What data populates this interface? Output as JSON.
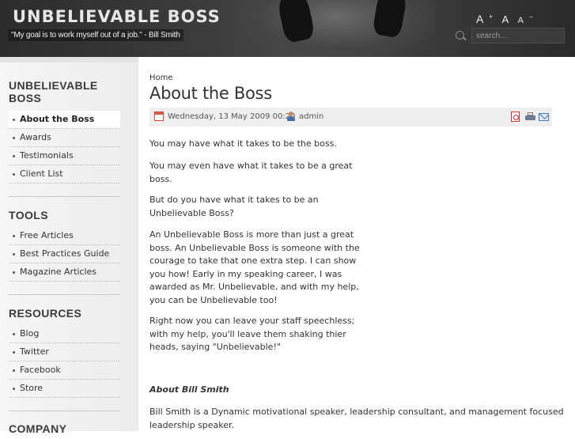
{
  "header": {
    "site_title": "UNBELIEVABLE BOSS",
    "tagline": "\"My goal is to work myself out of a job.\" - Bill Smith",
    "font_increase": "A",
    "font_reset": "A",
    "font_decrease": "A",
    "font_increase_sup": "+",
    "font_decrease_sup": "−",
    "search_placeholder": "search..."
  },
  "sidebar": {
    "modules": [
      {
        "title_line1": "UNBELIEVABLE",
        "title_line2": "BOSS",
        "items": [
          "About the Boss",
          "Awards",
          "Testimonials",
          "Client List"
        ],
        "active_index": 0
      },
      {
        "title": "TOOLS",
        "items": [
          "Free Articles",
          "Best Practices Guide",
          "Magazine Articles"
        ]
      },
      {
        "title": "RESOURCES",
        "items": [
          "Blog",
          "Twitter",
          "Facebook",
          "Store"
        ]
      },
      {
        "title": "COMPANY"
      }
    ]
  },
  "main": {
    "breadcrumb": "Home",
    "title": "About the Boss",
    "meta": {
      "date": "Wednesday, 13 May 2009 00:20",
      "author": "admin"
    },
    "paragraphs": [
      [
        "You may have what it takes to be the boss."
      ],
      [
        "You may even have what it takes to be a great",
        "boss."
      ],
      [
        "But do you have what it takes to be an",
        "Unbelievable Boss?"
      ],
      [
        "An Unbelievable Boss is more than just a great",
        "boss.  An Unbelievable Boss is someone with the",
        "courage to take that one extra step.  I can show",
        "you how!  Early in my speaking career, I was",
        "awarded as Mr. Unbelievable, and with my help,",
        "you can be Unbelievable too!"
      ],
      [
        "Right now you can leave your staff speechless;",
        "with my help, you'll leave them shaking thier",
        "heads, saying \"Unbelievable!\""
      ]
    ],
    "about_heading": "About Bill Smith",
    "about_text": [
      "Bill Smith is a Dynamic motivational speaker, leadership consultant, and management focused",
      "leadership speaker."
    ]
  },
  "colors": {
    "header_bg": "#3a3a3a",
    "sidebar_bg": "#efefef",
    "meta_bar_bg": "#efefef",
    "text": "#333333"
  }
}
